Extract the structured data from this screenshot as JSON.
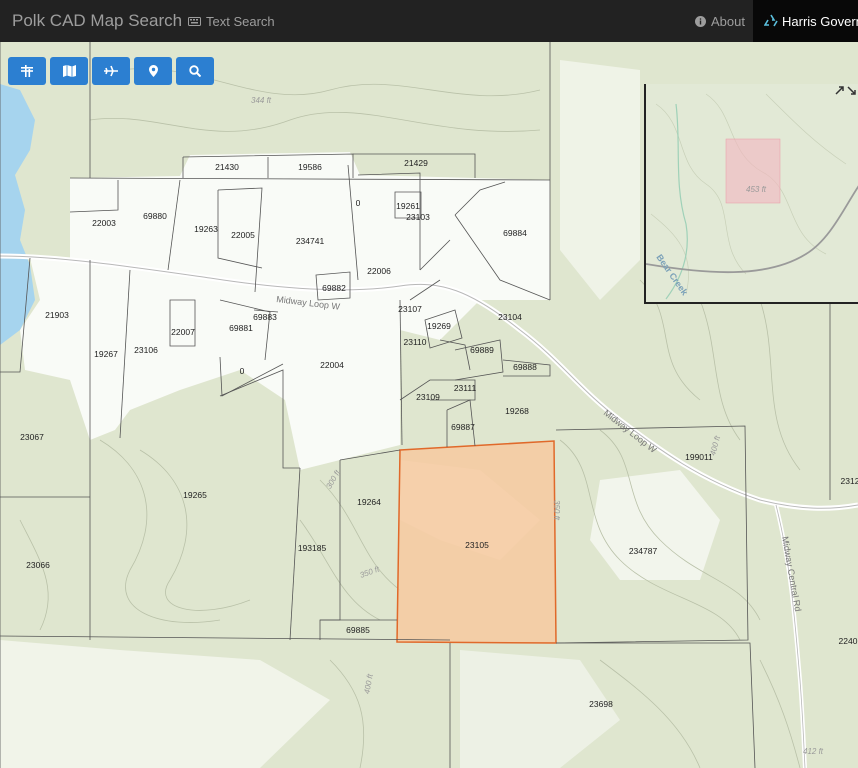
{
  "navbar": {
    "brand": "Polk CAD Map Search",
    "text_search": "Text Search",
    "about": "About",
    "user": "Harris Govern"
  },
  "toolbar": {
    "buttons": [
      "filter-icon",
      "map-icon",
      "airplane-icon",
      "location-pin-icon",
      "search-icon"
    ]
  },
  "map": {
    "colors": {
      "land": "#dfe6cf",
      "water": "#a6d4ee",
      "selected_fill": "#f7c9a0",
      "selected_stroke": "#e0692a",
      "parcel_line": "#555555"
    },
    "roads": {
      "midway_loop": "Midway Loop W",
      "midway_central": "Midway Central Rd"
    },
    "contours": {
      "c344": "344 ft",
      "c300": "300 ft",
      "c350a": "350 ft",
      "c350b": "350 ft",
      "c400a": "400 ft",
      "c400b": "400 ft",
      "c412": "412 ft"
    },
    "parcels": {
      "p21430": "21430",
      "p19586": "19586",
      "p21429": "21429",
      "p22003": "22003",
      "p69880": "69880",
      "p19263": "19263",
      "p22005": "22005",
      "p234741": "234741",
      "p0a": "0",
      "p19261": "19261",
      "p23103": "23103",
      "p69884": "69884",
      "p22006": "22006",
      "p69882": "69882",
      "p21903": "21903",
      "p23107": "23107",
      "p23104": "23104",
      "p69883": "69883",
      "p22007": "22007",
      "p69881": "69881",
      "p19269": "19269",
      "p23106": "23106",
      "p19267": "19267",
      "p23110": "23110",
      "p69889": "69889",
      "p69888": "69888",
      "p22004": "22004",
      "p0b": "0",
      "p23111": "23111",
      "p23109": "23109",
      "p19268": "19268",
      "p23067": "23067",
      "p69887": "69887",
      "p199011": "199011",
      "p2312": "2312",
      "p19265": "19265",
      "p19264": "19264",
      "p23105": "23105",
      "p234787": "234787",
      "p193185": "193185",
      "p23066": "23066",
      "p69885": "69885",
      "p2240": "2240",
      "p23698": "23698"
    },
    "inset": {
      "elevation": "453 ft",
      "creek": "Bear Creek"
    }
  }
}
